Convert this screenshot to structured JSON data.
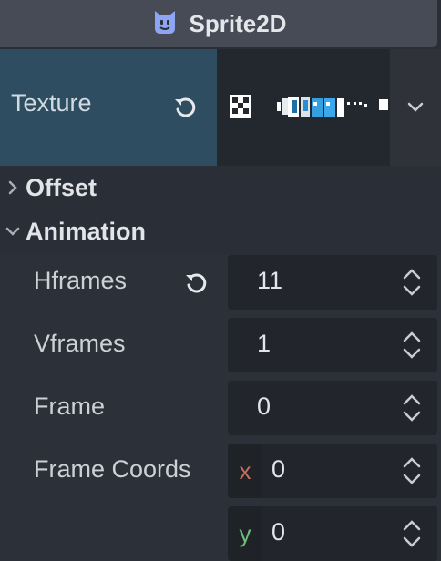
{
  "header": {
    "title": "Sprite2D",
    "icon": "sprite-node-icon",
    "icon_color": "#8da5f3"
  },
  "texture": {
    "label": "Texture",
    "revert_icon": "revert-icon",
    "menu_icon": "chevron-down-icon",
    "row_color": "#2f4d61"
  },
  "sections": {
    "offset": {
      "label": "Offset",
      "expanded": false
    },
    "animation": {
      "label": "Animation",
      "expanded": true
    }
  },
  "animation": {
    "hframes": {
      "label": "Hframes",
      "value": "11",
      "modified": true
    },
    "vframes": {
      "label": "Vframes",
      "value": "1"
    },
    "frame": {
      "label": "Frame",
      "value": "0"
    },
    "frame_coords": {
      "label": "Frame Coords",
      "x_label": "x",
      "x_value": "0",
      "x_color": "#c46f5f",
      "y_label": "y",
      "y_value": "0",
      "y_color": "#6fbf7a"
    }
  }
}
